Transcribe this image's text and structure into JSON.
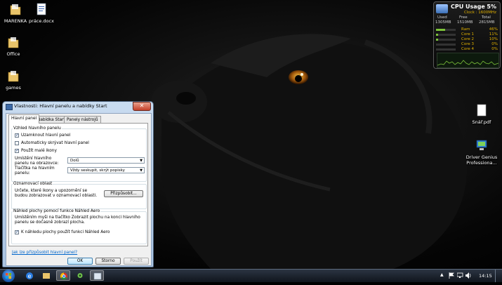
{
  "desktop": {
    "icons": [
      {
        "label": "MARENKA",
        "icon": "folder-icon"
      },
      {
        "label": "práce.docx",
        "icon": "word-document-icon"
      },
      {
        "label": "Office",
        "icon": "folder-icon"
      },
      {
        "label": "games",
        "icon": "folder-icon"
      },
      {
        "label": "Snář.pdf",
        "icon": "pdf-document-icon"
      },
      {
        "label": "Driver Genius Professiona...",
        "icon": "driver-genius-icon"
      }
    ]
  },
  "gadget": {
    "title": "CPU Usage",
    "percent": "5%",
    "clock": "Clock : 1600MHz",
    "headers": [
      "Used",
      "Free",
      "Total"
    ],
    "values": [
      "1305MB",
      "1510MB",
      "2815MB"
    ],
    "rows": [
      {
        "label": "Ram",
        "value": "46%",
        "fill": 0.46
      },
      {
        "label": "Core 1",
        "value": "11%",
        "fill": 0.11
      },
      {
        "label": "Core 2",
        "value": "10%",
        "fill": 0.1
      },
      {
        "label": "Core 3",
        "value": "0%",
        "fill": 0.0
      },
      {
        "label": "Core 4",
        "value": "0%",
        "fill": 0.0
      }
    ]
  },
  "dialog": {
    "title": "Vlastnosti: Hlavní panelu a nabídky Start",
    "close": "✕",
    "tabs": [
      "Hlavní panel",
      "Nabídka Start",
      "Panely nástrojů"
    ],
    "appearance": {
      "title": "Vzhled hlavního panelu",
      "lock": "Uzamknout hlavní panel",
      "autohide": "Automaticky skrývat hlavní panel",
      "small_icons": "Použít malé ikony",
      "location_label": "Umístění hlavního panelu na obrazovce:",
      "location_value": "Dolů",
      "buttons_label": "Tlačítka na hlavním panelu:",
      "buttons_value": "Vždy seskupit, skrýt popisky"
    },
    "notification": {
      "title": "Oznamovací oblast",
      "text": "Určete, které ikony a upozornění se budou zobrazovat v oznamovací oblasti.",
      "button": "Přizpůsobit..."
    },
    "aero": {
      "title": "Náhled plochy pomocí funkce Náhled Aero",
      "text": "Umístěním myši na tlačítko Zobrazit plochu na konci hlavního panelu se dočasně zobrazí plocha.",
      "checkbox": "K náhledu plochy použít funkci Náhled Aero"
    },
    "link": "Jak lze přizpůsobit hlavní panel?",
    "ok": "OK",
    "cancel": "Storno",
    "apply": "Použít"
  },
  "taskbar": {
    "clock": "14:15",
    "tray_arrow": "▲"
  },
  "colors": {
    "accent": "#3c7fb1",
    "gadget_text": "#e0b000",
    "link": "#0066cc"
  }
}
